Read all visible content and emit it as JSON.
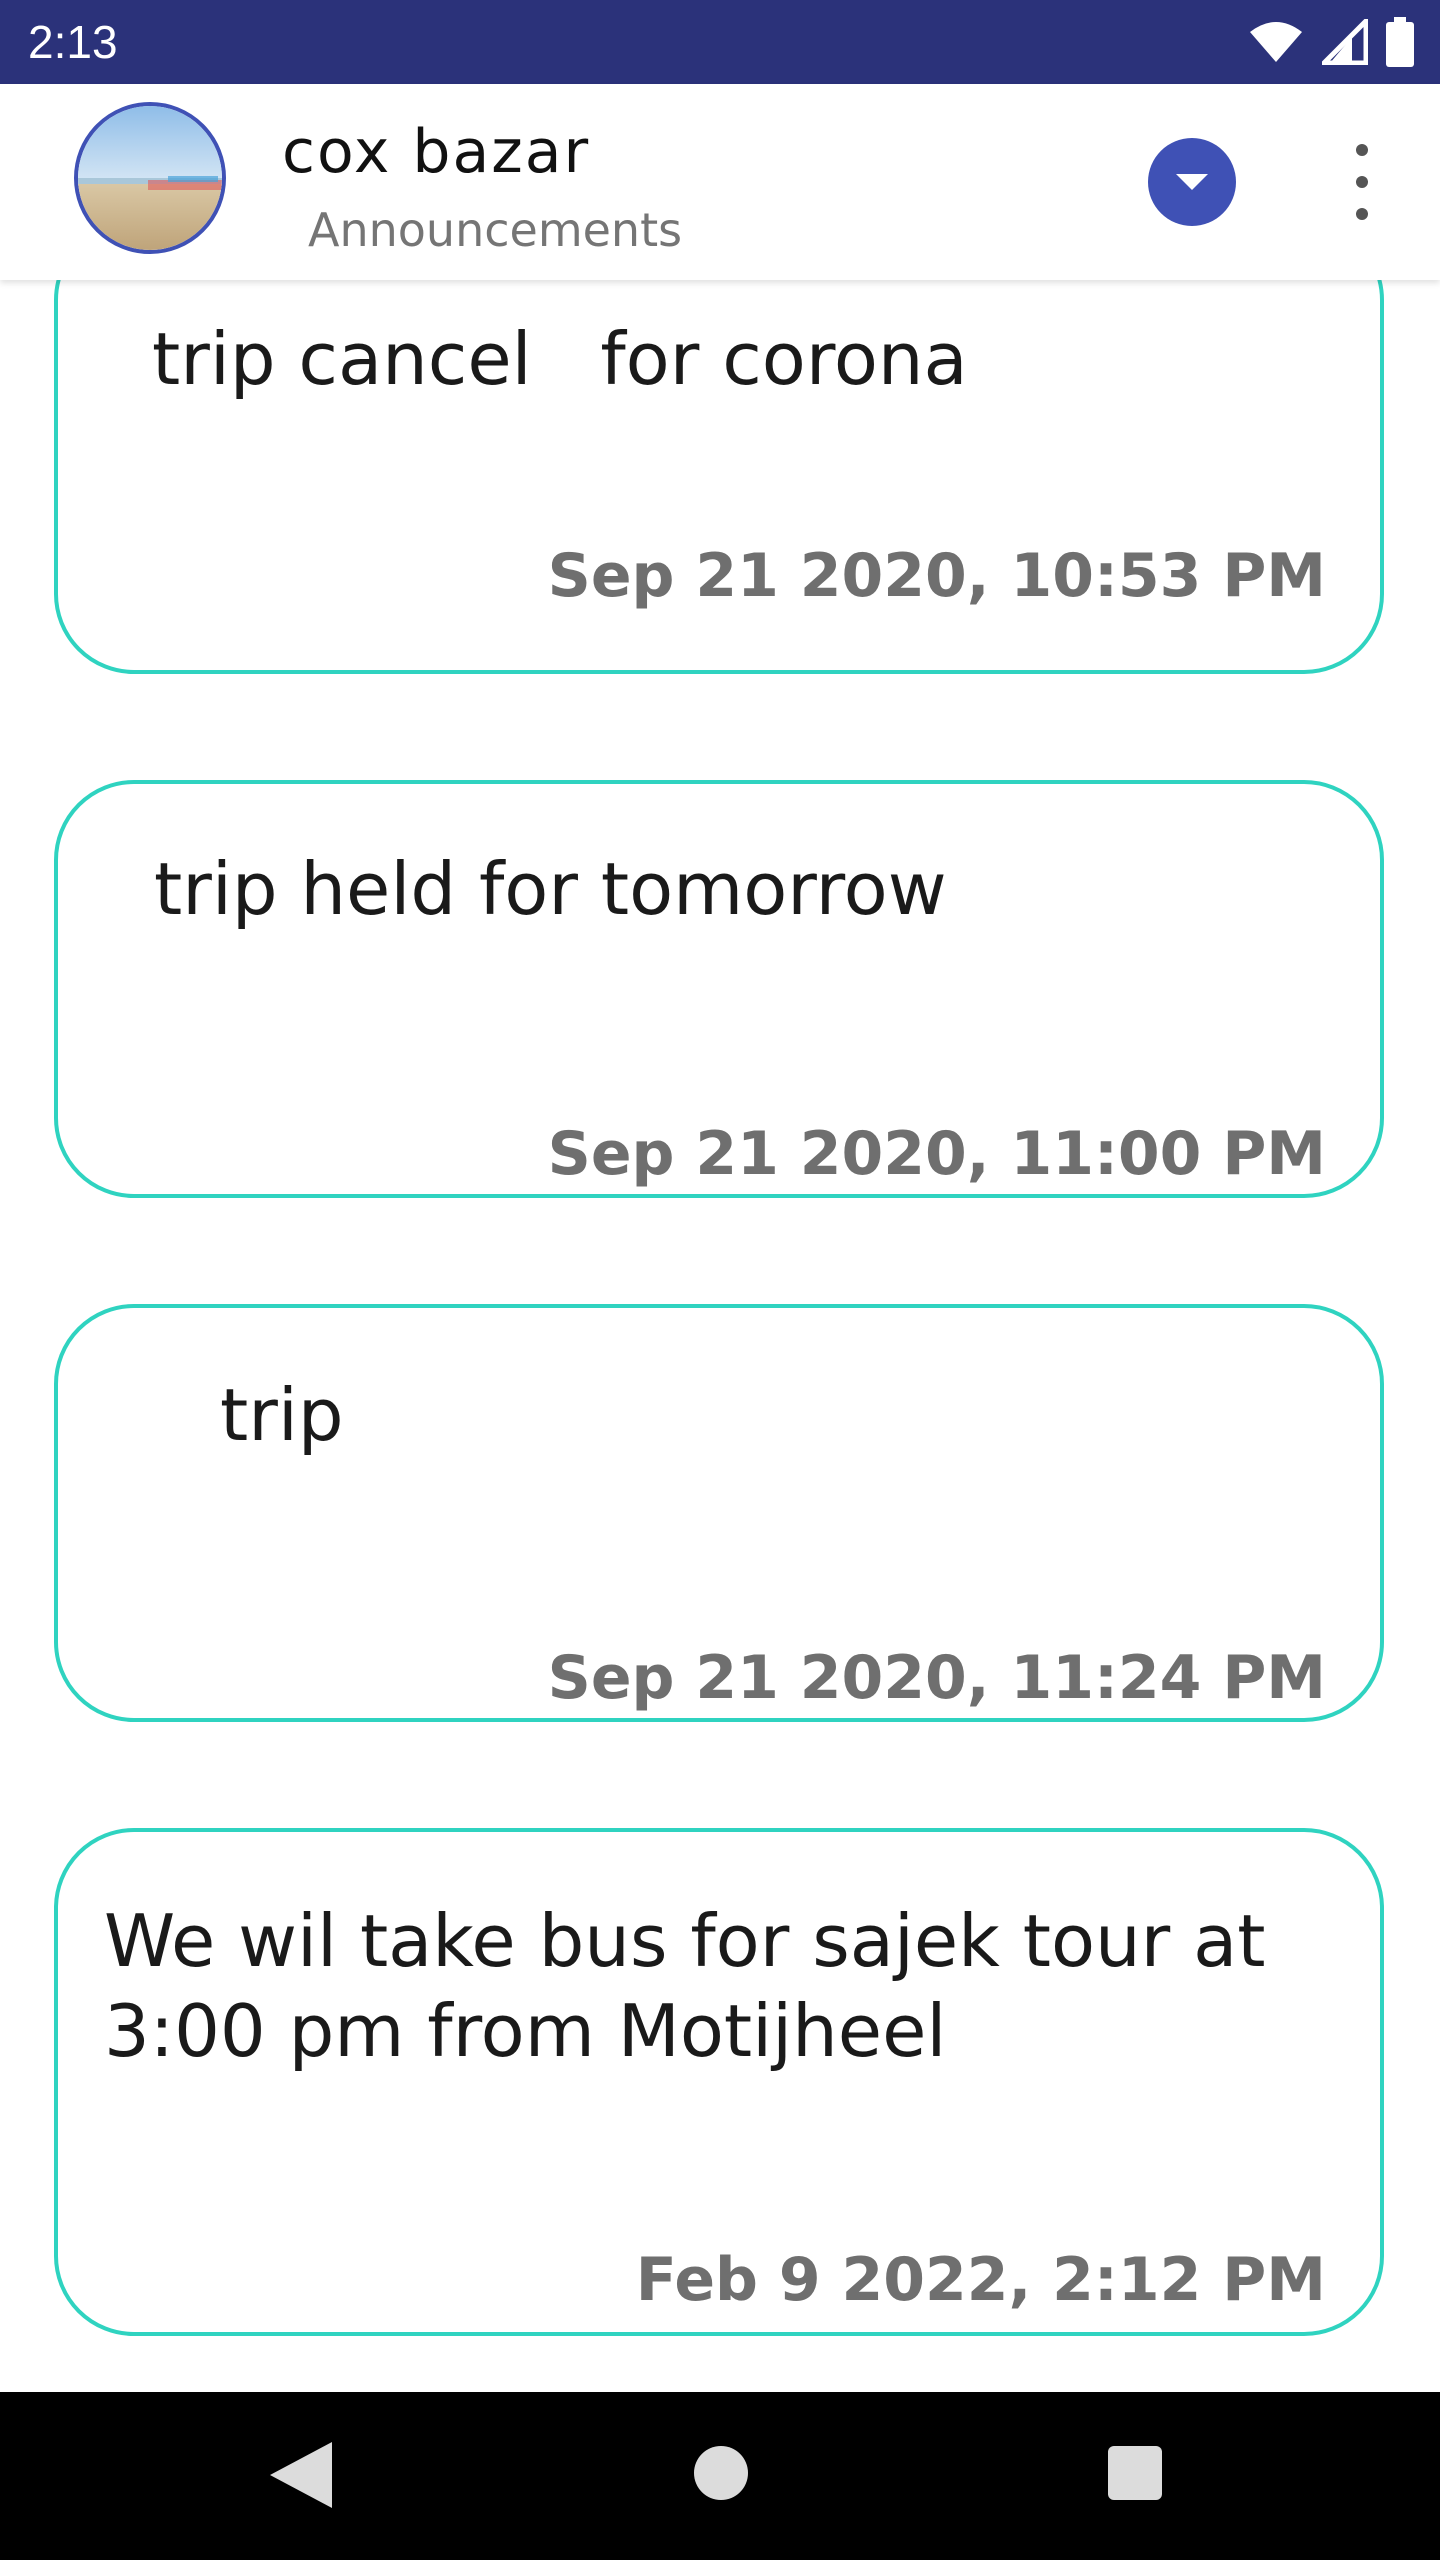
{
  "status_bar": {
    "time": "2:13",
    "icons": [
      "wifi-icon",
      "cell-signal-icon",
      "battery-icon"
    ],
    "background": "#2b327a"
  },
  "toolbar": {
    "group_name": "cox bazar",
    "subtitle": "Announcements",
    "dropdown_icon": "chevron-down-icon",
    "menu_icon": "more-vert-icon",
    "accent": "#3f51b5"
  },
  "announcements": [
    {
      "text": "trip cancel   for corona",
      "time": "Sep 21 2020, 10:53 PM"
    },
    {
      "text": "trip held for tomorrow",
      "time": "Sep 21 2020, 11:00 PM"
    },
    {
      "text": "trip",
      "time": "Sep 21 2020, 11:24 PM"
    },
    {
      "text": "We wil take bus for sajek tour at 3:00 pm from Motijheel",
      "time": "Feb 9 2022, 2:12 PM"
    }
  ],
  "card_border_color": "#2fd3c0",
  "nav_bar": {
    "icons": [
      "back-icon",
      "home-icon",
      "recents-icon"
    ]
  }
}
